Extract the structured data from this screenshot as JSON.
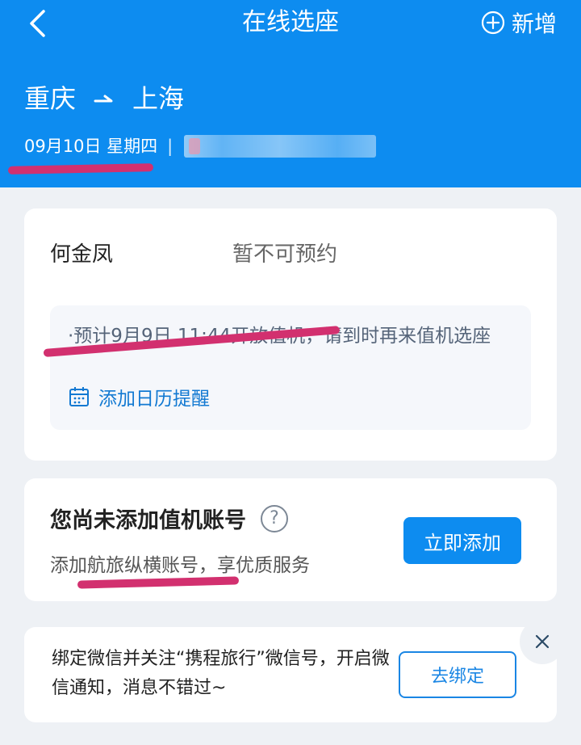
{
  "header": {
    "title": "在线选座",
    "add_label": "新增",
    "route": {
      "from": "重庆",
      "to": "上海"
    },
    "date": "09月10日 星期四",
    "separator": "|"
  },
  "passenger": {
    "name": "何金凤",
    "status": "暂不可预约",
    "notice": "·预计9月9日 11:44开放值机，请到时再来值机选座",
    "calendar_link": "添加日历提醒"
  },
  "account": {
    "title": "您尚未添加值机账号",
    "help": "?",
    "subtitle": "添加航旅纵横账号，享优质服务",
    "add_button": "立即添加"
  },
  "wechat": {
    "text": "绑定微信并关注“携程旅行”微信号，开启微信通知，消息不错过~",
    "bind_button": "去绑定"
  },
  "colors": {
    "primary": "#0d8cf0",
    "annotation": "#d2306f",
    "link": "#1279d2"
  }
}
